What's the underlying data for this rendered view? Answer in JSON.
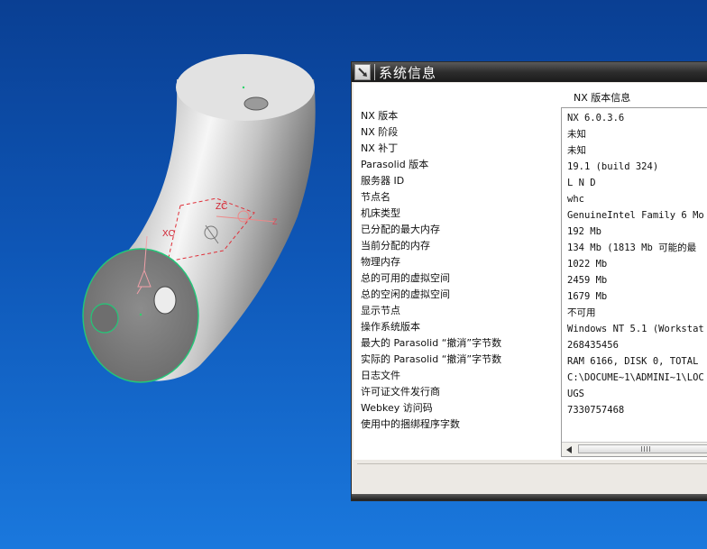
{
  "viewport": {
    "background_top": "#0a3f93",
    "background_bottom": "#1a78dd",
    "axis_labels": {
      "zc": "ZC",
      "xc": "XC",
      "z": "Z"
    }
  },
  "dialog": {
    "title": "系统信息",
    "pin_icon": "pin-icon",
    "column_header": "NX 版本信息",
    "rows": [
      {
        "label": "NX 版本",
        "value": "NX 6.0.3.6"
      },
      {
        "label": "NX 阶段",
        "value": "未知"
      },
      {
        "label": "NX 补丁",
        "value": "未知"
      },
      {
        "label": "Parasolid 版本",
        "value": "19.1 (build 324)"
      },
      {
        "label": "服务器 ID",
        "value": "L N D"
      },
      {
        "label": "节点名",
        "value": "whc"
      },
      {
        "label": "机床类型",
        "value": "GenuineIntel Family 6 Mo"
      },
      {
        "label": "已分配的最大内存",
        "value": "192 Mb"
      },
      {
        "label": "当前分配的内存",
        "value": "134 Mb (1813 Mb 可能的最"
      },
      {
        "label": "物理内存",
        "value": "1022 Mb"
      },
      {
        "label": "总的可用的虚拟空间",
        "value": "2459 Mb"
      },
      {
        "label": "总的空闲的虚拟空间",
        "value": "1679 Mb"
      },
      {
        "label": "显示节点",
        "value": "不可用"
      },
      {
        "label": "操作系统版本",
        "value": "Windows NT 5.1 (Workstat"
      },
      {
        "label": "最大的 Parasolid “撤消”字节数",
        "value": "268435456"
      },
      {
        "label": "实际的 Parasolid “撤消”字节数",
        "value": "RAM 6166, DISK 0, TOTAL"
      },
      {
        "label": "日志文件",
        "value": "C:\\DOCUME~1\\ADMINI~1\\LOC"
      },
      {
        "label": "许可证文件发行商",
        "value": "UGS"
      },
      {
        "label": "Webkey 访问码",
        "value": "7330757468"
      },
      {
        "label": "使用中的捆绑程序字数",
        "value": ""
      }
    ]
  }
}
